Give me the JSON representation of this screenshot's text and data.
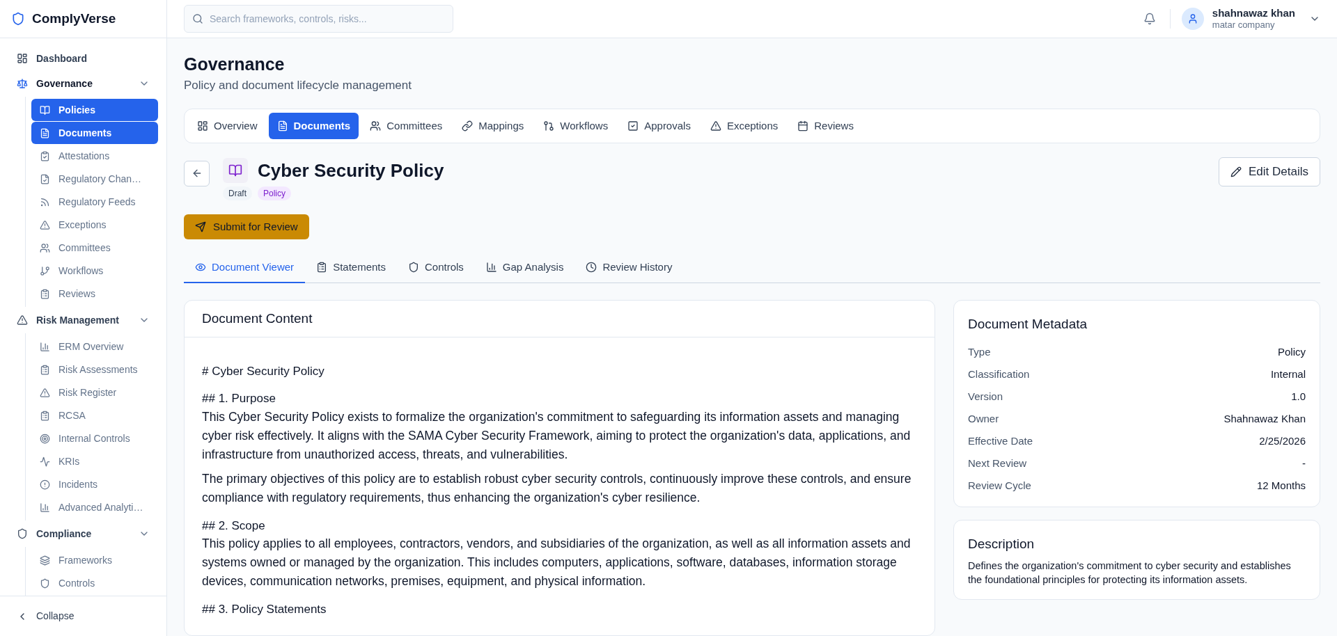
{
  "sidebar": {
    "brand": "ComplyVerse",
    "items": [
      {
        "kind": "link",
        "label": "Dashboard",
        "selected": false
      },
      {
        "kind": "group",
        "label": "Governance",
        "selected": true,
        "expanded": true,
        "children": [
          {
            "label": "Policies",
            "selected": true
          },
          {
            "label": "Documents",
            "selected": true
          },
          {
            "label": "Attestations",
            "selected": false
          },
          {
            "label": "Regulatory Chan…",
            "selected": false
          },
          {
            "label": "Regulatory Feeds",
            "selected": false
          },
          {
            "label": "Exceptions",
            "selected": false
          },
          {
            "label": "Committees",
            "selected": false
          },
          {
            "label": "Workflows",
            "selected": false
          },
          {
            "label": "Reviews",
            "selected": false
          }
        ]
      },
      {
        "kind": "group",
        "label": "Risk Management",
        "selected": false,
        "expanded": true,
        "children": [
          {
            "label": "ERM Overview",
            "selected": false
          },
          {
            "label": "Risk Assessments",
            "selected": false
          },
          {
            "label": "Risk Register",
            "selected": false
          },
          {
            "label": "RCSA",
            "selected": false
          },
          {
            "label": "Internal Controls",
            "selected": false
          },
          {
            "label": "KRIs",
            "selected": false
          },
          {
            "label": "Incidents",
            "selected": false
          },
          {
            "label": "Advanced Analyti…",
            "selected": false
          }
        ]
      },
      {
        "kind": "group",
        "label": "Compliance",
        "selected": false,
        "expanded": true,
        "children": [
          {
            "label": "Frameworks",
            "selected": false
          },
          {
            "label": "Controls",
            "selected": false
          }
        ]
      }
    ],
    "collapse": "Collapse"
  },
  "header": {
    "search": {
      "placeholder": "Search frameworks, controls, risks..."
    },
    "user": {
      "name": "shahnawaz khan",
      "company": "matar company"
    }
  },
  "page": {
    "title": "Governance",
    "subtitle": "Policy and document lifecycle management"
  },
  "tabs": [
    {
      "label": "Overview",
      "selected": false
    },
    {
      "label": "Documents",
      "selected": true
    },
    {
      "label": "Committees",
      "selected": false
    },
    {
      "label": "Mappings",
      "selected": false
    },
    {
      "label": "Workflows",
      "selected": false
    },
    {
      "label": "Approvals",
      "selected": false
    },
    {
      "label": "Exceptions",
      "selected": false
    },
    {
      "label": "Reviews",
      "selected": false
    }
  ],
  "document": {
    "title": "Cyber Security Policy",
    "badges": [
      {
        "kind": "status",
        "label": "Draft"
      },
      {
        "kind": "type",
        "label": "Policy"
      }
    ],
    "edit_button": "Edit Details",
    "submit_button": "Submit for Review"
  },
  "doc_tabs": [
    {
      "label": "Document Viewer",
      "selected": true
    },
    {
      "label": "Statements",
      "selected": false
    },
    {
      "label": "Controls",
      "selected": false
    },
    {
      "label": "Gap Analysis",
      "selected": false
    },
    {
      "label": "Review History",
      "selected": false
    }
  ],
  "content": {
    "title": "Document Content",
    "blocks": [
      {
        "kind": "heading",
        "text": "# Cyber Security Policy"
      },
      {
        "kind": "subheading",
        "text": "## 1. Purpose"
      },
      {
        "kind": "paragraph",
        "text": "This Cyber Security Policy exists to formalize the organization's commitment to safeguarding its information assets and managing cyber risk effectively. It aligns with the SAMA Cyber Security Framework, aiming to protect the organization's data, applications, and infrastructure from unauthorized access, threats, and vulnerabilities."
      },
      {
        "kind": "paragraph",
        "text": "The primary objectives of this policy are to establish robust cyber security controls, continuously improve these controls, and ensure compliance with regulatory requirements, thus enhancing the organization's cyber resilience."
      },
      {
        "kind": "subheading",
        "text": "## 2. Scope"
      },
      {
        "kind": "paragraph",
        "text": "This policy applies to all employees, contractors, vendors, and subsidiaries of the organization, as well as all information assets and systems owned or managed by the organization. This includes computers, applications, software, databases, information storage devices, communication networks, premises, equipment, and physical information."
      },
      {
        "kind": "subheading",
        "text": "## 3. Policy Statements"
      }
    ]
  },
  "metadata": {
    "title": "Document Metadata",
    "rows": [
      {
        "label": "Type",
        "value": "Policy"
      },
      {
        "label": "Classification",
        "value": "Internal"
      },
      {
        "label": "Version",
        "value": "1.0"
      },
      {
        "label": "Owner",
        "value": "Shahnawaz Khan"
      },
      {
        "label": "Effective Date",
        "value": "2/25/2026"
      },
      {
        "label": "Next Review",
        "value": "-"
      },
      {
        "label": "Review Cycle",
        "value": "12 Months"
      }
    ]
  },
  "description": {
    "title": "Description",
    "text": "Defines the organization's commitment to cyber security and establishes the foundational principles for protecting its information assets."
  }
}
